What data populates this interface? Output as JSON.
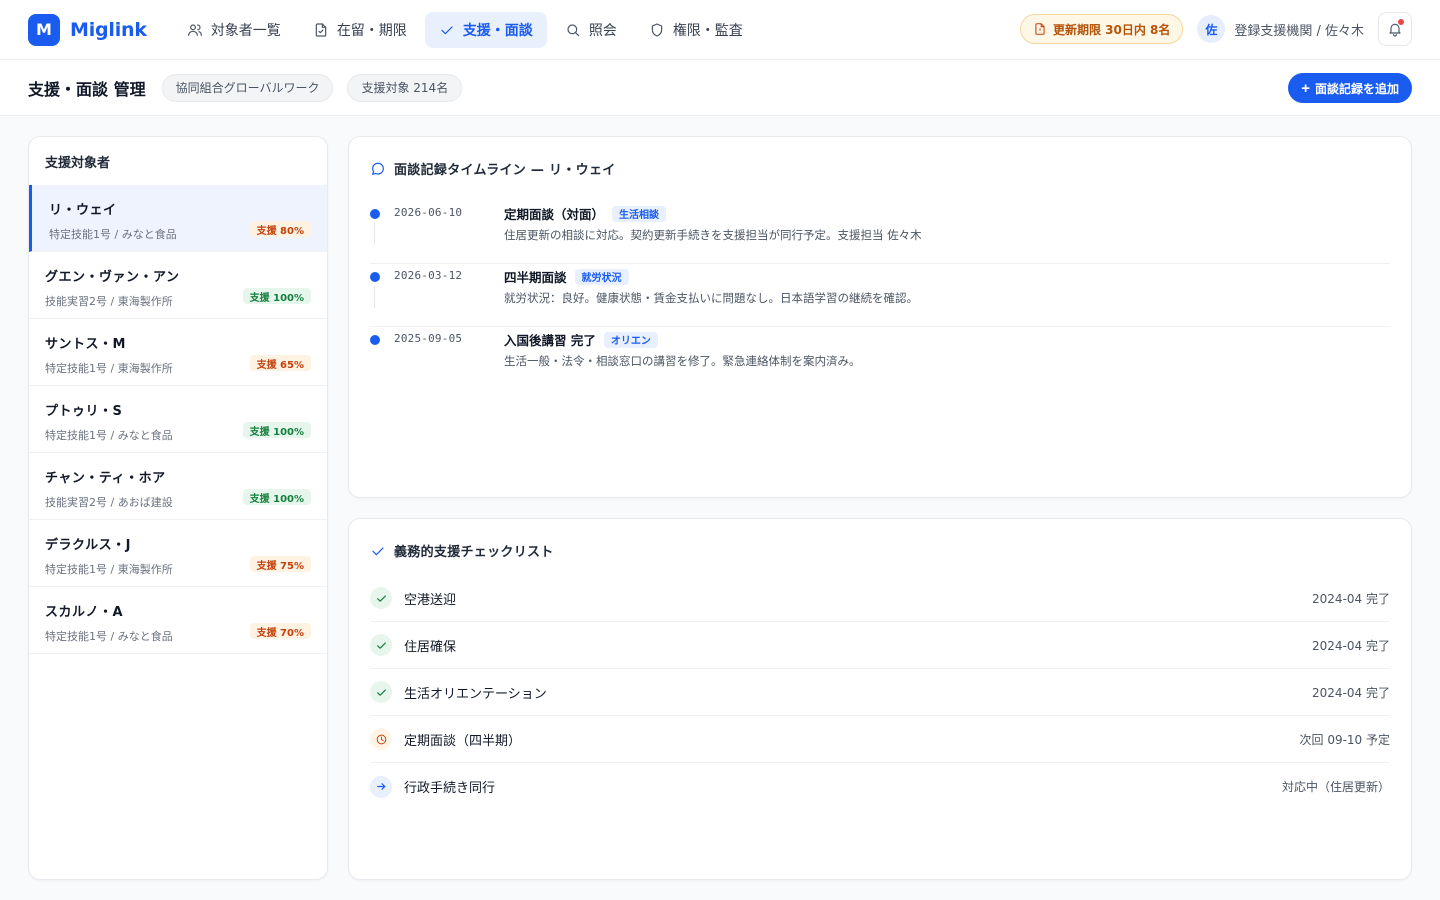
{
  "brand": {
    "logo_letter": "M",
    "name": "Miglink",
    "color": "#1a5cf0"
  },
  "nav": {
    "items": [
      {
        "label": "対象者一覧",
        "icon": "users-icon"
      },
      {
        "label": "在留・期限",
        "icon": "document-icon"
      },
      {
        "label": "支援・面談",
        "icon": "check-icon",
        "active": true
      },
      {
        "label": "照会",
        "icon": "search-icon"
      },
      {
        "label": "権限・監査",
        "icon": "shield-icon"
      }
    ]
  },
  "header_right": {
    "alert_label": "更新期限 30日内 8名",
    "avatar_initial": "佐",
    "user_label": "登録支援機関 / 佐々木"
  },
  "page": {
    "title": "支援・面談 管理",
    "org_chip": "協同組合グローバルワーク",
    "count_chip": "支援対象 214名",
    "add_button": "面談記録を追加"
  },
  "left_panel": {
    "title": "支援対象者",
    "people": [
      {
        "name": "リ・ウェイ",
        "meta": "特定技能1号 / みなと食品",
        "badge": "支援 80%",
        "status": "warn",
        "selected": true
      },
      {
        "name": "グエン・ヴァン・アン",
        "meta": "技能実習2号 / 東海製作所",
        "badge": "支援 100%",
        "status": "ok"
      },
      {
        "name": "サントス・M",
        "meta": "特定技能1号 / 東海製作所",
        "badge": "支援 65%",
        "status": "warn"
      },
      {
        "name": "プトゥリ・S",
        "meta": "特定技能1号 / みなと食品",
        "badge": "支援 100%",
        "status": "ok"
      },
      {
        "name": "チャン・ティ・ホア",
        "meta": "技能実習2号 / あおば建設",
        "badge": "支援 100%",
        "status": "ok"
      },
      {
        "name": "デラクルス・J",
        "meta": "特定技能1号 / 東海製作所",
        "badge": "支援 75%",
        "status": "warn"
      },
      {
        "name": "スカルノ・A",
        "meta": "特定技能1号 / みなと食品",
        "badge": "支援 70%",
        "status": "warn"
      }
    ]
  },
  "timeline": {
    "title": "面談記録タイムライン — リ・ウェイ",
    "entries": [
      {
        "date": "2026-06-10",
        "title": "定期面談（対面）",
        "tag": "生活相談",
        "desc": "住居更新の相談に対応。契約更新手続きを支援担当が同行予定。支援担当 佐々木"
      },
      {
        "date": "2026-03-12",
        "title": "四半期面談",
        "tag": "就労状況",
        "desc": "就労状況：良好。健康状態・賃金支払いに問題なし。日本語学習の継続を確認。"
      },
      {
        "date": "2025-09-05",
        "title": "入国後講習 完了",
        "tag": "オリエン",
        "desc": "生活一般・法令・相談窓口の講習を修了。緊急連絡体制を案内済み。"
      }
    ]
  },
  "checklist": {
    "title": "義務的支援チェックリスト",
    "items": [
      {
        "label": "空港送迎",
        "status": "2024-04 完了",
        "state": "done",
        "icon": "check-icon"
      },
      {
        "label": "住居確保",
        "status": "2024-04 完了",
        "state": "done",
        "icon": "check-icon"
      },
      {
        "label": "生活オリエンテーション",
        "status": "2024-04 完了",
        "state": "done",
        "icon": "check-icon"
      },
      {
        "label": "定期面談（四半期）",
        "status": "次回 09-10 予定",
        "state": "pending",
        "icon": "clock-icon"
      },
      {
        "label": "行政手続き同行",
        "status": "対応中（住居更新）",
        "state": "progress",
        "icon": "arrow-right-icon"
      }
    ]
  }
}
